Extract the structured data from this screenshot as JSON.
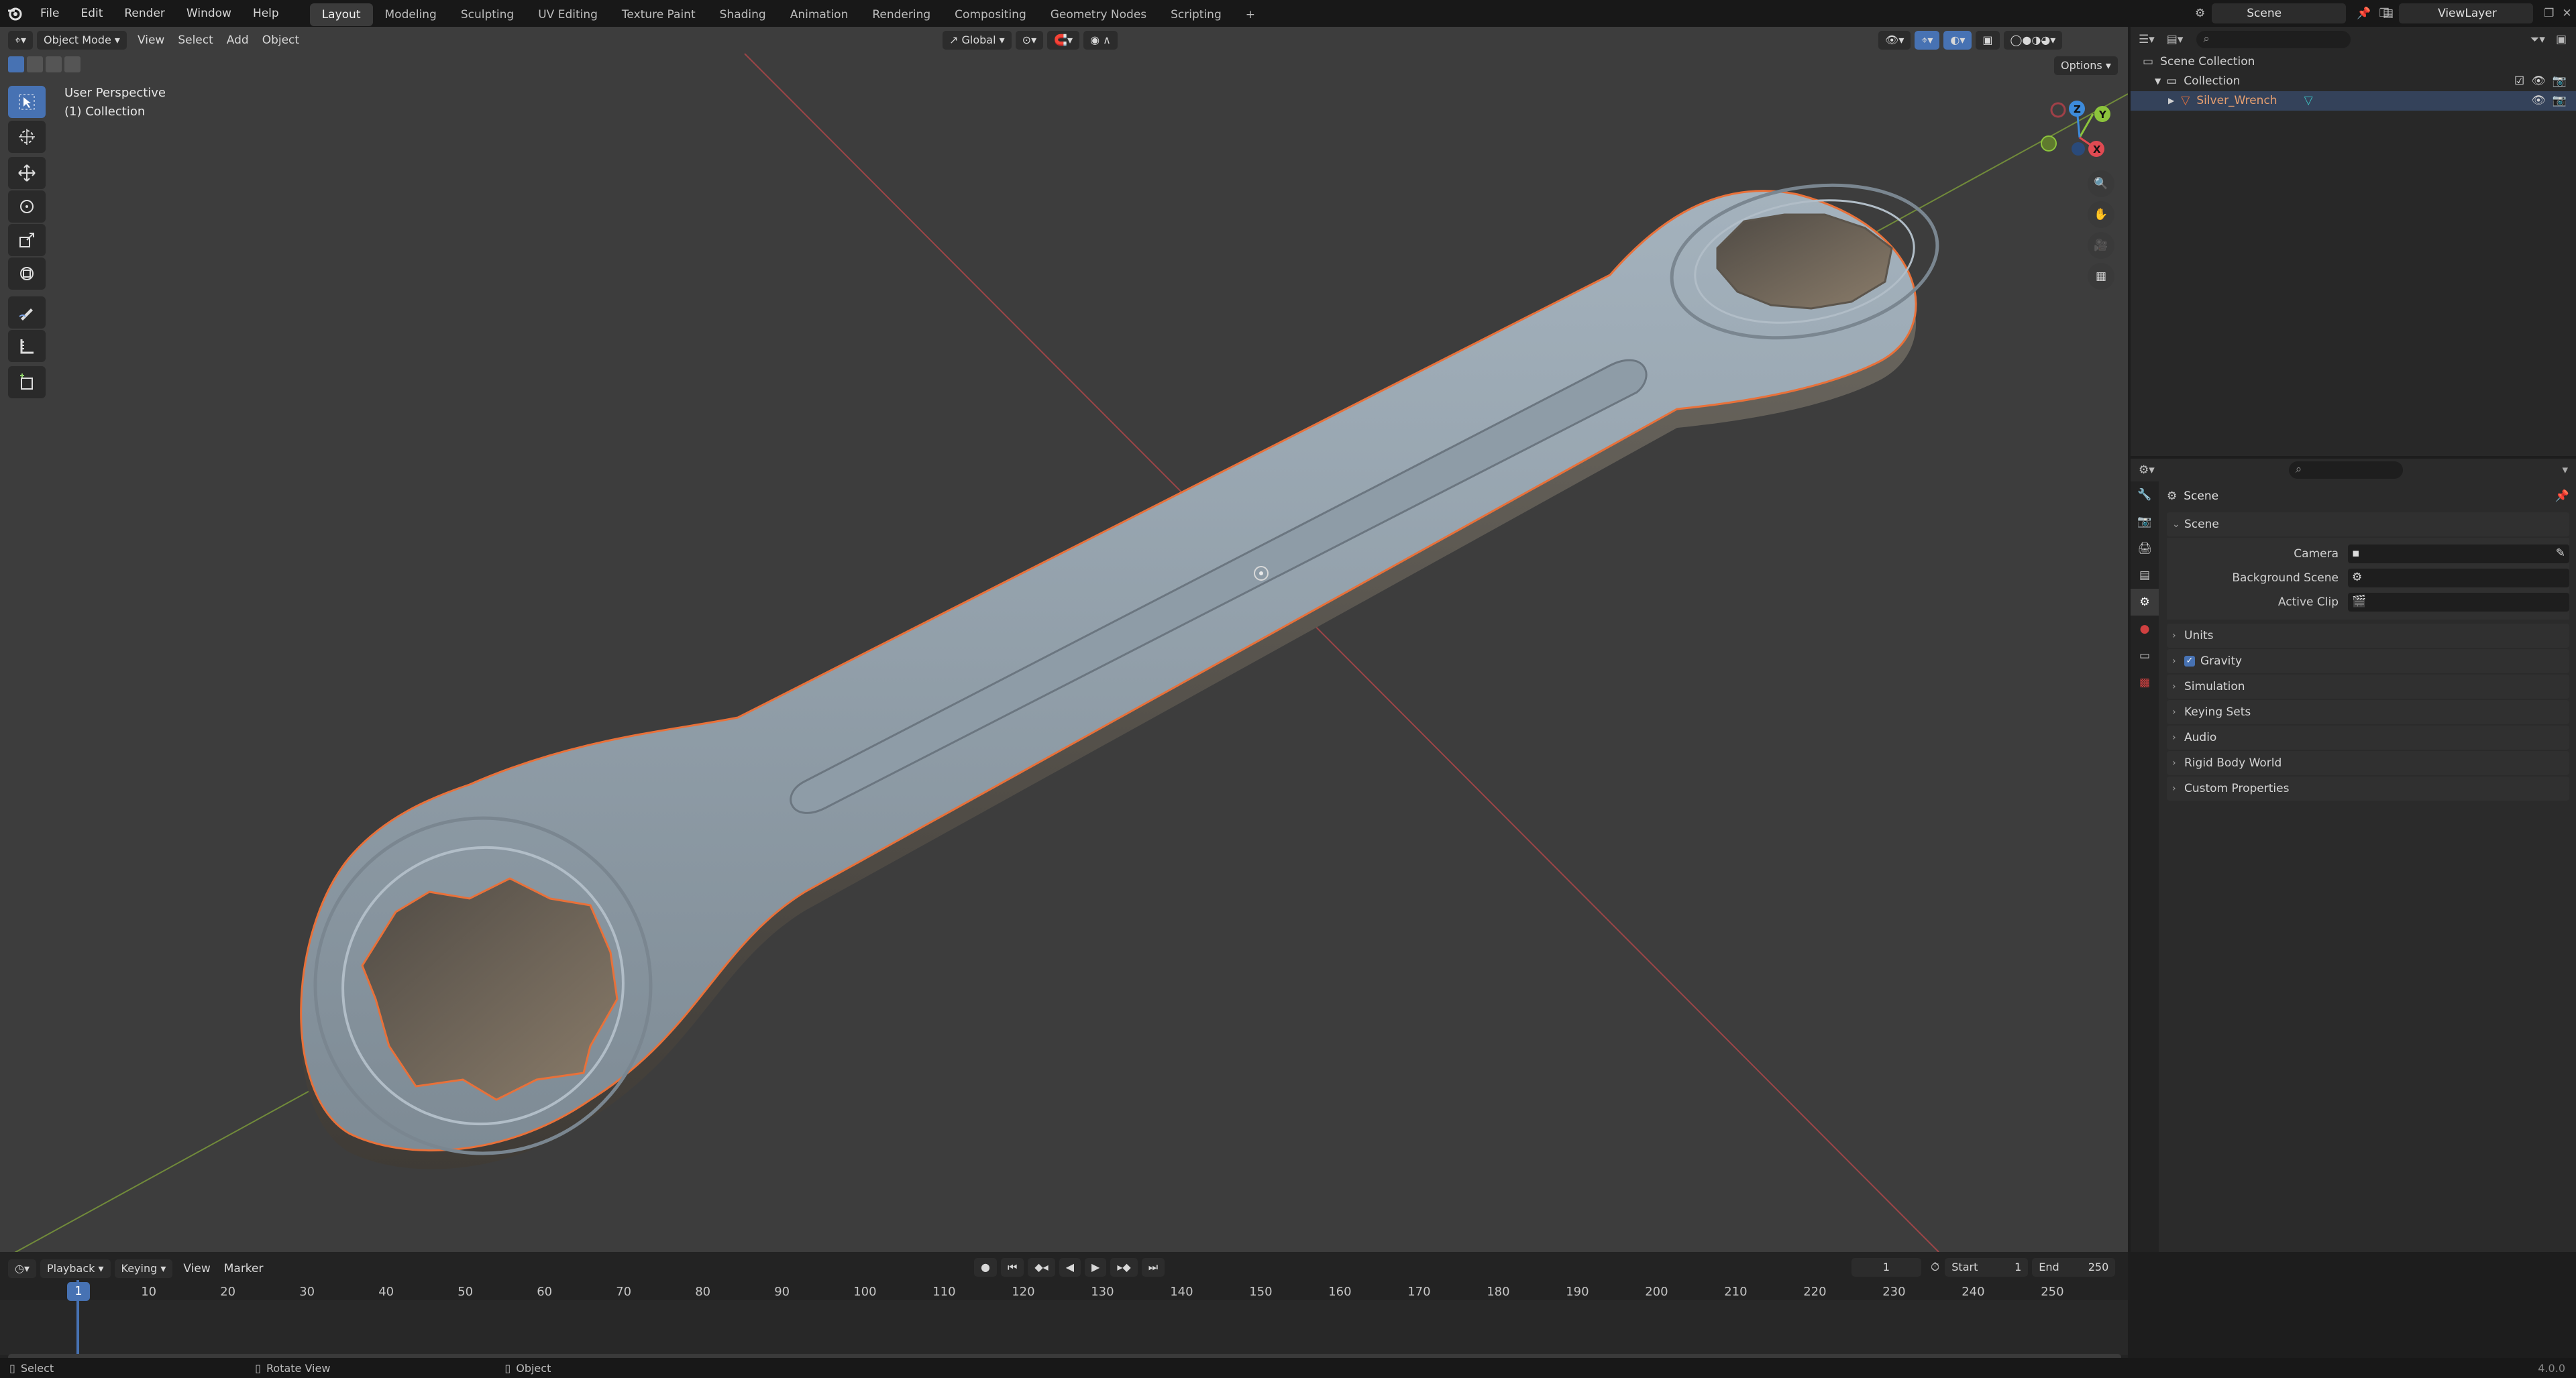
{
  "app": {
    "menu": [
      "File",
      "Edit",
      "Render",
      "Window",
      "Help"
    ],
    "workspaces": [
      "Layout",
      "Modeling",
      "Sculpting",
      "UV Editing",
      "Texture Paint",
      "Shading",
      "Animation",
      "Rendering",
      "Compositing",
      "Geometry Nodes",
      "Scripting"
    ],
    "active_workspace": "Layout",
    "scene_name": "Scene",
    "view_layer": "ViewLayer"
  },
  "viewport": {
    "mode": "Object Mode",
    "menus": [
      "View",
      "Select",
      "Add",
      "Object"
    ],
    "transform_orientation": "Global",
    "options_label": "Options",
    "overlay_title": "User Perspective",
    "overlay_subtitle": "(1) Collection",
    "axis_labels": {
      "x": "X",
      "y": "Y",
      "z": "Z"
    }
  },
  "outliner": {
    "root": "Scene Collection",
    "collection": "Collection",
    "object": "Silver_Wrench"
  },
  "properties": {
    "context_title": "Scene",
    "panel": "Scene",
    "fields": [
      {
        "label": "Camera"
      },
      {
        "label": "Background Scene"
      },
      {
        "label": "Active Clip"
      }
    ],
    "sections": [
      "Units",
      "Gravity",
      "Simulation",
      "Keying Sets",
      "Audio",
      "Rigid Body World",
      "Custom Properties"
    ],
    "gravity_enabled": true
  },
  "timeline": {
    "menus": [
      "Playback",
      "Keying",
      "View",
      "Marker"
    ],
    "current_frame": "1",
    "start_label": "Start",
    "start_value": "1",
    "end_label": "End",
    "end_value": "250",
    "ticks": [
      "1",
      "10",
      "20",
      "30",
      "40",
      "50",
      "60",
      "70",
      "80",
      "90",
      "100",
      "110",
      "120",
      "130",
      "140",
      "150",
      "160",
      "170",
      "180",
      "190",
      "200",
      "210",
      "220",
      "230",
      "240",
      "250"
    ],
    "playhead_label": "1"
  },
  "status": {
    "select": "Select",
    "rotate": "Rotate View",
    "object": "Object",
    "version": "4.0.0"
  },
  "colors": {
    "accent": "#4772b3",
    "selection_outline": "#e8713a",
    "object_color": "#8795a0"
  }
}
